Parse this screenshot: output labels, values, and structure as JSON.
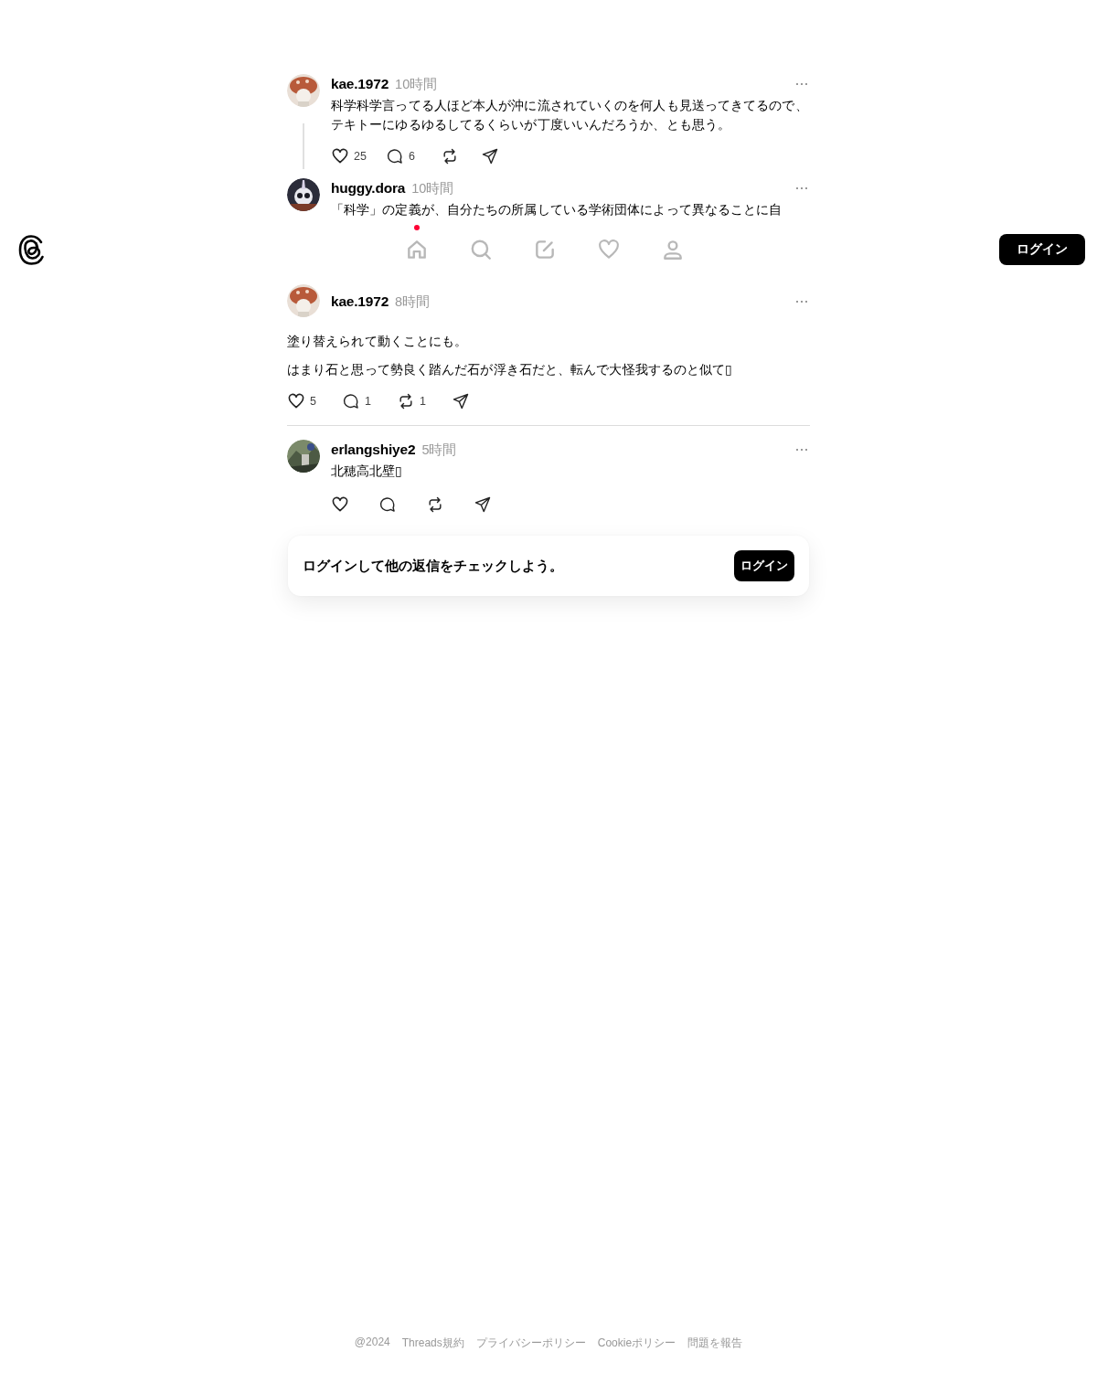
{
  "header": {
    "nav": [
      {
        "kind": "home",
        "dot": true
      },
      {
        "kind": "search",
        "dot": false
      },
      {
        "kind": "compose",
        "dot": false
      },
      {
        "kind": "heart",
        "dot": false
      },
      {
        "kind": "person",
        "dot": false
      }
    ],
    "login_button": "ログイン"
  },
  "posts": [
    {
      "kind": "parent",
      "username": "kae.1972",
      "time": "10時間",
      "paragraphs": [
        "科学科学言ってる人ほど本人が沖に流されていくのを何人も見送ってきてるので、テキトーにゆるゆるしてるくらいが丁度いいんだろうか、とも思う。"
      ],
      "likes": "25",
      "replies": "6"
    },
    {
      "kind": "covered",
      "username": "huggy.dora",
      "time": "10時間",
      "paragraphs": [
        "「科学」の定義が、自分たちの所属している学術団体によって異なることに自"
      ]
    },
    {
      "kind": "main",
      "username": "kae.1972",
      "time": "8時間",
      "paragraphs": [
        "塗り替えられて動くことにも。",
        "はまり石と思って勢良く踏んだ石が浮き石だと、転んで大怪我するのと似て▯"
      ],
      "likes": "5",
      "replies": "1",
      "reposts": "1"
    },
    {
      "kind": "reply",
      "username": "erlangshiye2",
      "time": "5時間",
      "paragraphs": [
        "北穂高北壁▯"
      ]
    }
  ],
  "login_prompt": {
    "text": "ログインして他の返信をチェックしよう。",
    "button": "ログイン"
  },
  "footer": [
    "@2024",
    "Threads規約",
    "プライバシーポリシー",
    "Cookieポリシー",
    "問題を報告"
  ]
}
